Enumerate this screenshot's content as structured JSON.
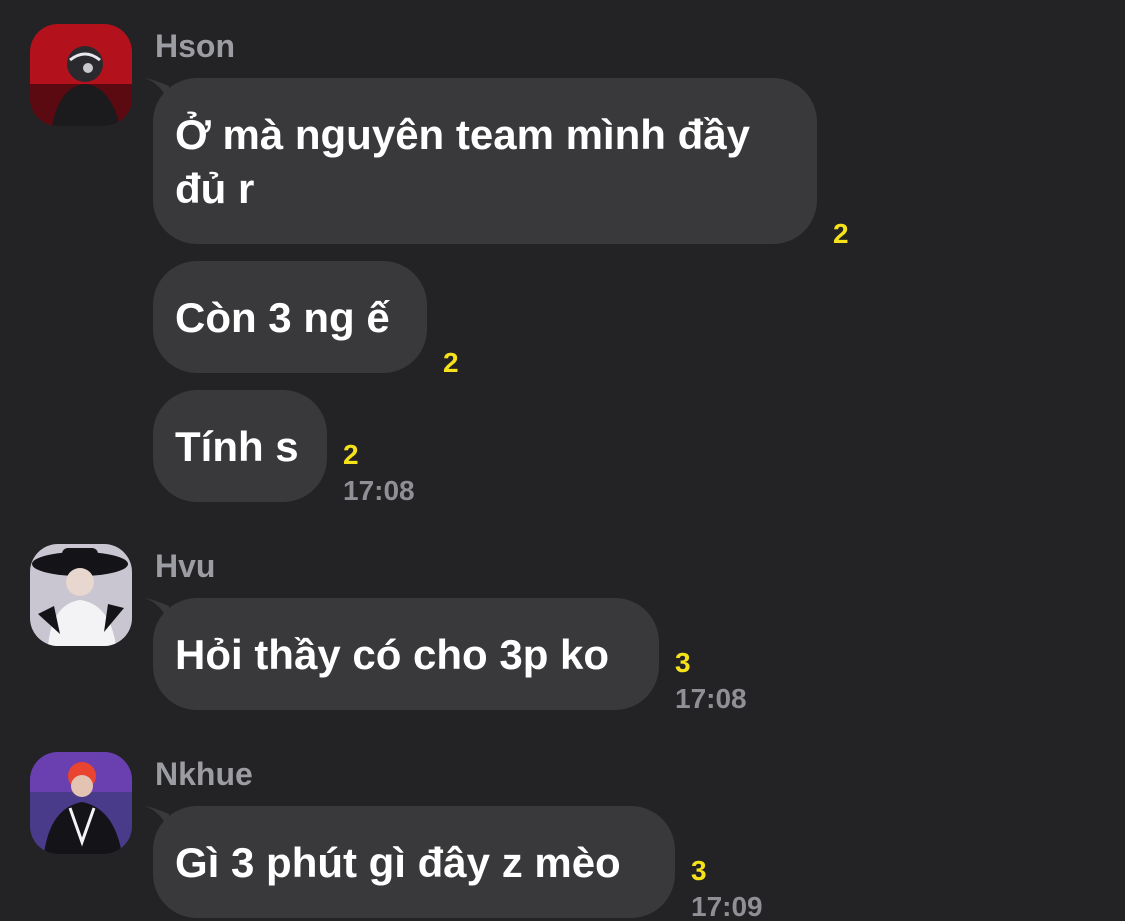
{
  "colors": {
    "background": "#232325",
    "bubble": "#39393c",
    "sender_name": "#9c9ca3",
    "message_text": "#ffffff",
    "seen_count": "#f5e21a",
    "timestamp": "#8f8f95"
  },
  "groups": [
    {
      "sender": "Hson",
      "avatar_icon": "user-avatar-icon",
      "messages": [
        {
          "text": "Ở mà nguyên team mình đầy đủ r",
          "seen_count": "2"
        },
        {
          "text": "Còn 3 ng ế",
          "seen_count": "2"
        },
        {
          "text": "Tính s",
          "seen_count": "2",
          "time": "17:08"
        }
      ]
    },
    {
      "sender": "Hvu",
      "avatar_icon": "user-avatar-icon",
      "messages": [
        {
          "text": "Hỏi thầy có cho 3p ko",
          "seen_count": "3",
          "time": "17:08"
        }
      ]
    },
    {
      "sender": "Nkhue",
      "avatar_icon": "user-avatar-icon",
      "messages": [
        {
          "text": "Gì 3 phút gì đây z mèo",
          "seen_count": "3",
          "time": "17:09"
        }
      ]
    }
  ]
}
